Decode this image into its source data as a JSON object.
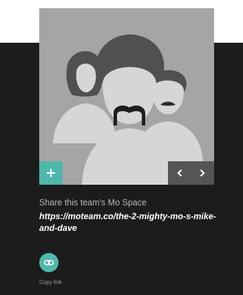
{
  "share": {
    "heading": "Share this team's Mo Space",
    "url": "https://moteam.co/the-2-mighty-mo-s-mike-and-dave",
    "copy_link_label": "Copy link"
  },
  "controls": {
    "add_label": "+",
    "prev_label": "‹",
    "next_label": "›"
  },
  "icons": {
    "add": "plus-icon",
    "prev": "chevron-left-icon",
    "next": "chevron-right-icon",
    "copy_link": "link-icon",
    "avatar": "team-silhouettes-icon"
  },
  "colors": {
    "panel_background": "#1c1c1c",
    "card_background": "#a5a5a7",
    "accent": "#4fb8ac",
    "nav_background": "#555557"
  }
}
